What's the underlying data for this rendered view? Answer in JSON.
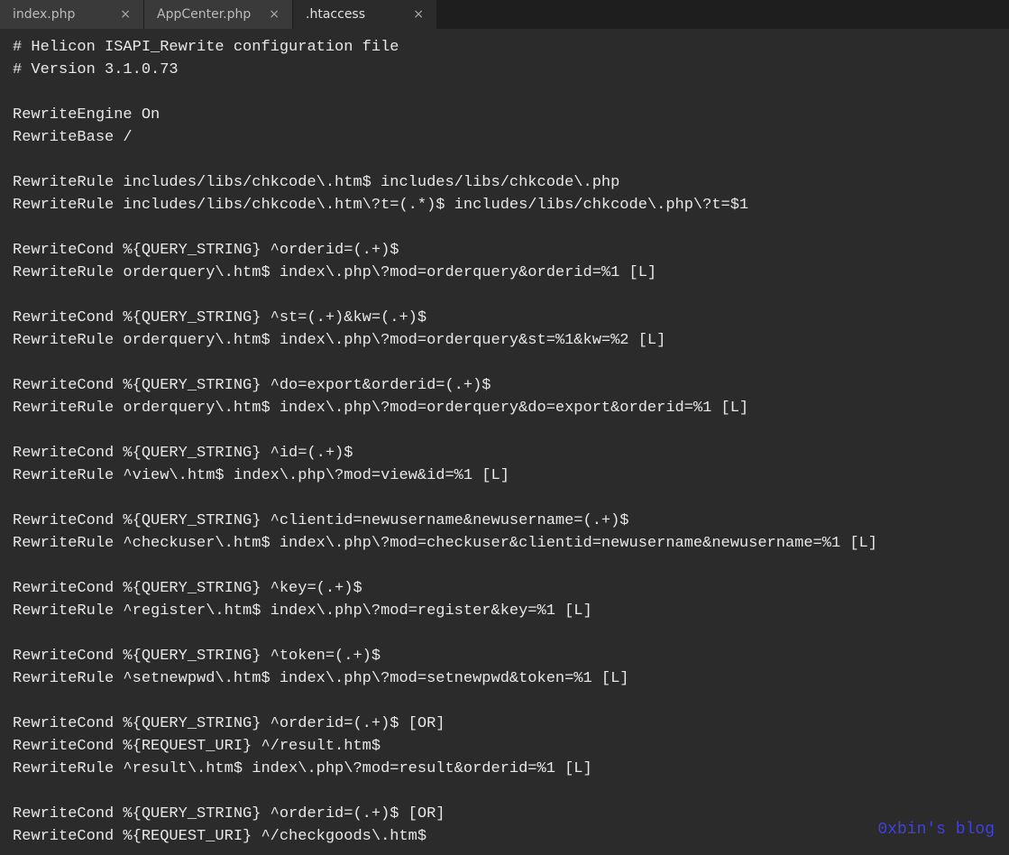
{
  "tabs": [
    {
      "label": "index.php",
      "active": false
    },
    {
      "label": "AppCenter.php",
      "active": false
    },
    {
      "label": ".htaccess",
      "active": true
    }
  ],
  "close_symbol": "×",
  "code_lines": [
    "# Helicon ISAPI_Rewrite configuration file",
    "# Version 3.1.0.73",
    "",
    "RewriteEngine On",
    "RewriteBase /",
    "",
    "RewriteRule includes/libs/chkcode\\.htm$ includes/libs/chkcode\\.php",
    "RewriteRule includes/libs/chkcode\\.htm\\?t=(.*)$ includes/libs/chkcode\\.php\\?t=$1",
    "",
    "RewriteCond %{QUERY_STRING} ^orderid=(.+)$",
    "RewriteRule orderquery\\.htm$ index\\.php\\?mod=orderquery&orderid=%1 [L]",
    "",
    "RewriteCond %{QUERY_STRING} ^st=(.+)&kw=(.+)$",
    "RewriteRule orderquery\\.htm$ index\\.php\\?mod=orderquery&st=%1&kw=%2 [L]",
    "",
    "RewriteCond %{QUERY_STRING} ^do=export&orderid=(.+)$",
    "RewriteRule orderquery\\.htm$ index\\.php\\?mod=orderquery&do=export&orderid=%1 [L]",
    "",
    "RewriteCond %{QUERY_STRING} ^id=(.+)$",
    "RewriteRule ^view\\.htm$ index\\.php\\?mod=view&id=%1 [L]",
    "",
    "RewriteCond %{QUERY_STRING} ^clientid=newusername&newusername=(.+)$",
    "RewriteRule ^checkuser\\.htm$ index\\.php\\?mod=checkuser&clientid=newusername&newusername=%1 [L]",
    "",
    "RewriteCond %{QUERY_STRING} ^key=(.+)$",
    "RewriteRule ^register\\.htm$ index\\.php\\?mod=register&key=%1 [L]",
    "",
    "RewriteCond %{QUERY_STRING} ^token=(.+)$",
    "RewriteRule ^setnewpwd\\.htm$ index\\.php\\?mod=setnewpwd&token=%1 [L]",
    "",
    "RewriteCond %{QUERY_STRING} ^orderid=(.+)$ [OR]",
    "RewriteCond %{REQUEST_URI} ^/result.htm$",
    "RewriteRule ^result\\.htm$ index\\.php\\?mod=result&orderid=%1 [L]",
    "",
    "RewriteCond %{QUERY_STRING} ^orderid=(.+)$ [OR]",
    "RewriteCond %{REQUEST_URI} ^/checkgoods\\.htm$"
  ],
  "watermark": "0xbin's blog"
}
